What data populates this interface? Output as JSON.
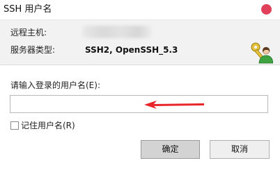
{
  "window": {
    "title": "SSH 用户名",
    "close_icon": "close-icon"
  },
  "info": {
    "remote_host_label": "远程主机:",
    "server_type_label": "服务器类型:",
    "server_type_value": "SSH2, OpenSSH_5.3",
    "icon": "keys-user-icon"
  },
  "form": {
    "prompt": "请输入登录的用户名(E):",
    "username_value": "",
    "annotation_arrow_color": "#e8262a",
    "remember_label": "记住用户名(R)",
    "remember_checked": false
  },
  "buttons": {
    "ok": "确定",
    "cancel": "取消"
  },
  "colors": {
    "close": "#e0405a",
    "info_bg": "#f2f2f2",
    "ok_bg": "#d3d3d3"
  }
}
